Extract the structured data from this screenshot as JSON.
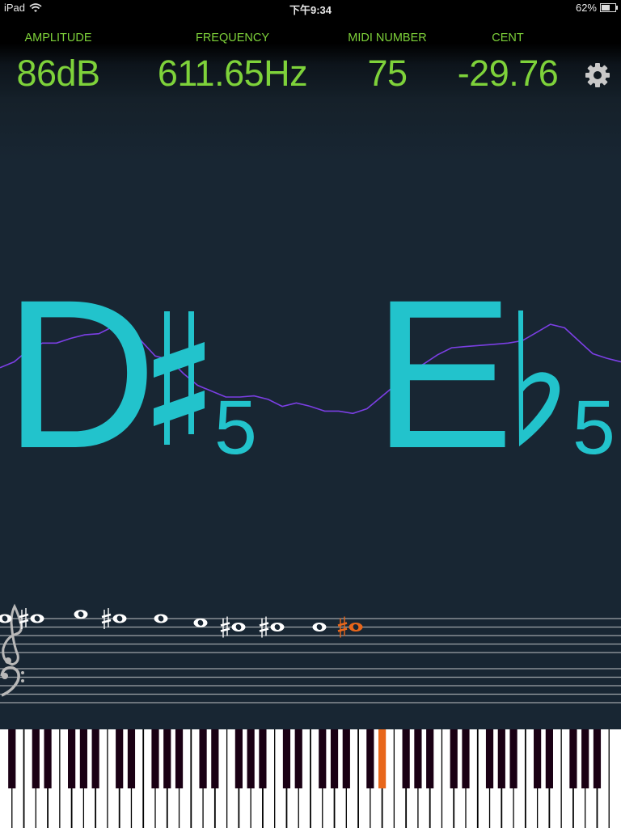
{
  "status_bar": {
    "device": "iPad",
    "time": "下午9:34",
    "battery": "62%",
    "battery_level": 0.62,
    "wifi_icon": "wifi-icon",
    "battery_icon": "battery-charging-icon"
  },
  "metrics": {
    "amplitude": {
      "label": "AMPLITUDE",
      "value": "86dB"
    },
    "frequency": {
      "label": "FREQUENCY",
      "value": "611.65Hz"
    },
    "midi": {
      "label": "MIDI NUMBER",
      "value": "75"
    },
    "cent": {
      "label": "CENT",
      "value": "-29.76"
    },
    "settings_icon": "gear-icon",
    "color": "#7ed23a"
  },
  "pitch_display": {
    "sharp_name": {
      "letter": "D",
      "accidental": "sharp",
      "octave": "5"
    },
    "flat_name": {
      "letter": "E",
      "accidental": "flat",
      "octave": "5"
    },
    "note_color": "#22c3cc",
    "waveform_color": "#7b3fe4",
    "waveform": [
      0.45,
      0.5,
      0.6,
      0.66,
      0.66,
      0.7,
      0.73,
      0.74,
      0.8,
      0.8,
      0.68,
      0.55,
      0.52,
      0.4,
      0.3,
      0.25,
      0.2,
      0.2,
      0.21,
      0.18,
      0.12,
      0.15,
      0.12,
      0.08,
      0.08,
      0.06,
      0.1,
      0.2,
      0.3,
      0.42,
      0.48,
      0.56,
      0.62,
      0.63,
      0.64,
      0.65,
      0.66,
      0.68,
      0.75,
      0.82,
      0.79,
      0.68,
      0.57,
      0.53,
      0.5
    ]
  },
  "staff": {
    "clefs": [
      "treble-clef",
      "bass-clef"
    ],
    "notes": [
      {
        "pitch": "F5",
        "sharp": false,
        "active": false
      },
      {
        "pitch": "F#5",
        "sharp": true,
        "active": false
      },
      {
        "pitch": "G5",
        "sharp": false,
        "active": false
      },
      {
        "pitch": "F#5",
        "sharp": true,
        "active": false
      },
      {
        "pitch": "F5",
        "sharp": false,
        "active": false
      },
      {
        "pitch": "E5",
        "sharp": false,
        "active": false
      },
      {
        "pitch": "D#5",
        "sharp": true,
        "active": false
      },
      {
        "pitch": "D#5",
        "sharp": true,
        "active": false
      },
      {
        "pitch": "D5",
        "sharp": false,
        "active": false
      },
      {
        "pitch": "D#5",
        "sharp": true,
        "active": true
      }
    ],
    "note_color": "#ffffff",
    "active_color": "#e8661a"
  },
  "piano": {
    "lowest_midi": 21,
    "highest_midi": 108,
    "active_midi": 75,
    "active_color": "#e8661a",
    "black_key_color": "#1a0014"
  }
}
